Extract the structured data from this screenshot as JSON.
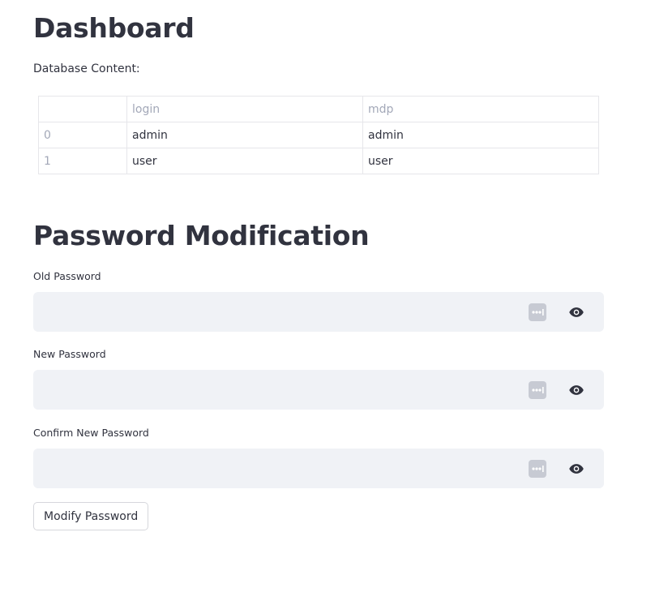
{
  "dashboard": {
    "title": "Dashboard",
    "db_label": "Database Content:",
    "table": {
      "columns": [
        "",
        "login",
        "mdp"
      ],
      "rows": [
        {
          "index": "0",
          "login": "admin",
          "mdp": "admin"
        },
        {
          "index": "1",
          "login": "user",
          "mdp": "user"
        }
      ]
    }
  },
  "password_form": {
    "title": "Password Modification",
    "old_password": {
      "label": "Old Password",
      "value": ""
    },
    "new_password": {
      "label": "New Password",
      "value": ""
    },
    "confirm_password": {
      "label": "Confirm New Password",
      "value": ""
    },
    "submit_label": "Modify Password"
  },
  "icons": {
    "password_manager": "password-manager-dots-icon",
    "show_password": "eye-icon"
  },
  "colors": {
    "text": "#31333f",
    "muted": "#a3a8b8",
    "input_bg": "#f0f2f6",
    "border": "#e6e6ea"
  }
}
